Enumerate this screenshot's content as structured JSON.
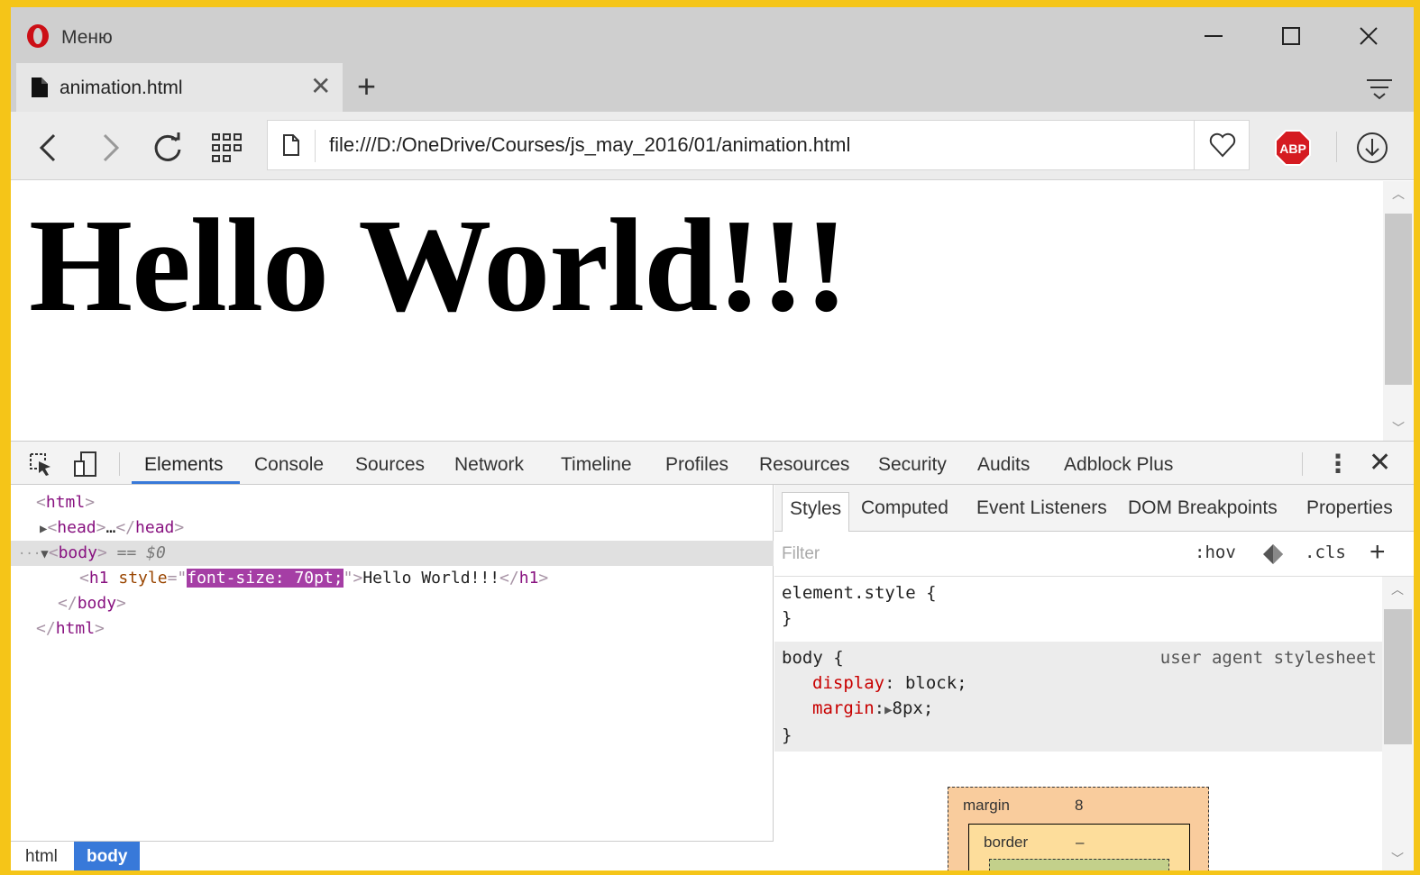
{
  "window": {
    "menu_label": "Меню",
    "tab_title": "animation.html",
    "new_tab_symbol": "+",
    "close_symbol": "✕"
  },
  "toolbar": {
    "url": "file:///D:/OneDrive/Courses/js_may_2016/01/animation.html",
    "abp_label": "ABP"
  },
  "page": {
    "heading": "Hello World!!!"
  },
  "devtools": {
    "tabs": [
      "Elements",
      "Console",
      "Sources",
      "Network",
      "Timeline",
      "Profiles",
      "Resources",
      "Security",
      "Audits",
      "Adblock Plus"
    ],
    "active_tab": "Elements",
    "dom": {
      "html_open": "html",
      "head_collapsed": "…",
      "head": "head",
      "body": "body",
      "selected_marker": "== $0",
      "h1_tag": "h1",
      "h1_attr": "style",
      "h1_style_value": "font-size: 70pt;",
      "h1_text": "Hello World!!!",
      "html_close": "html"
    },
    "breadcrumbs": [
      "html",
      "body"
    ],
    "styles_tabs": [
      "Styles",
      "Computed",
      "Event Listeners",
      "DOM Breakpoints",
      "Properties"
    ],
    "filter_placeholder": "Filter",
    "hov": ":hov",
    "cls": ".cls",
    "plus": "+",
    "element_style": {
      "selector": "element.style {",
      "close": "}"
    },
    "body_rule": {
      "selector": "body {",
      "origin": "user agent stylesheet",
      "props": [
        {
          "name": "display",
          "value": "block;"
        },
        {
          "name": "margin",
          "value": "8px;"
        }
      ],
      "close": "}"
    },
    "box_model": {
      "margin_label": "margin",
      "margin_value": "8",
      "border_label": "border",
      "border_value": "–"
    }
  },
  "colors": {
    "frame": "#f5c518",
    "accent": "#3879d9",
    "highlight": "#a53ea5",
    "opera_red": "#cc0f16",
    "abp_red": "#d51b21"
  }
}
